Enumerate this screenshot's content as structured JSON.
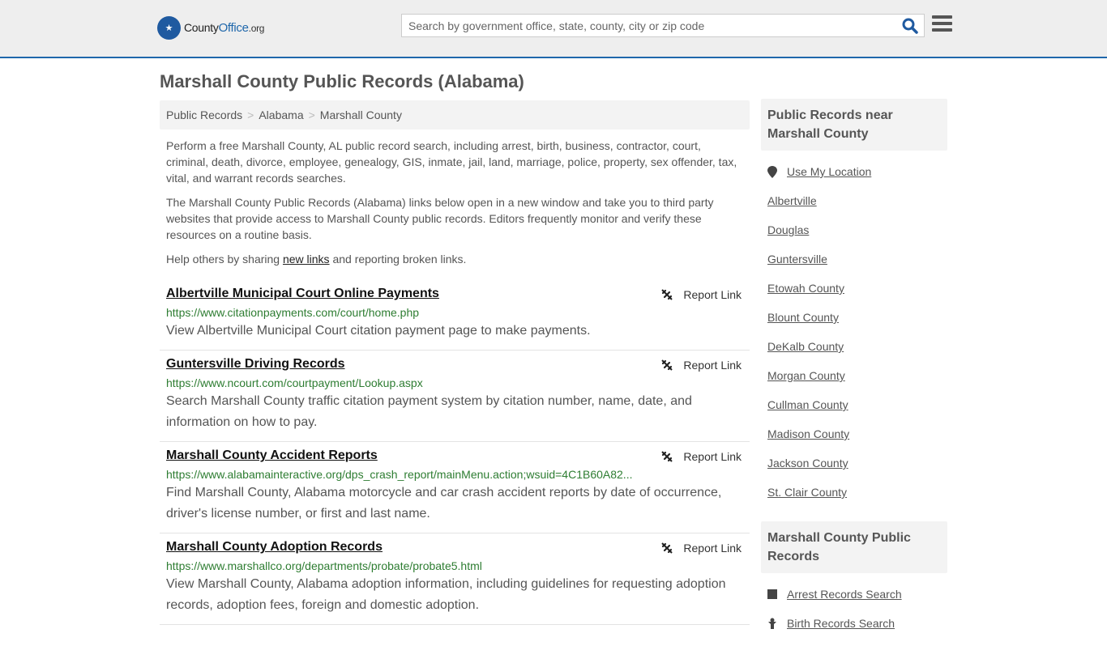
{
  "header": {
    "logo_name": "County",
    "logo_bold": "Office",
    "logo_suffix": ".org",
    "search_placeholder": "Search by government office, state, county, city or zip code"
  },
  "page_title": "Marshall County Public Records (Alabama)",
  "breadcrumb": [
    "Public Records",
    "Alabama",
    "Marshall County"
  ],
  "intro": {
    "p1": "Perform a free Marshall County, AL public record search, including arrest, birth, business, contractor, court, criminal, death, divorce, employee, genealogy, GIS, inmate, jail, land, marriage, police, property, sex offender, tax, vital, and warrant records searches.",
    "p2": "The Marshall County Public Records (Alabama) links below open in a new window and take you to third party websites that provide access to Marshall County public records. Editors frequently monitor and verify these resources on a routine basis.",
    "p3_before": "Help others by sharing ",
    "p3_link": "new links",
    "p3_after": " and reporting broken links."
  },
  "report_label": "Report Link",
  "records": [
    {
      "title": "Albertville Municipal Court Online Payments",
      "url": "https://www.citationpayments.com/court/home.php",
      "desc": "View Albertville Municipal Court citation payment page to make payments."
    },
    {
      "title": "Guntersville Driving Records",
      "url": "https://www.ncourt.com/courtpayment/Lookup.aspx",
      "desc": "Search Marshall County traffic citation payment system by citation number, name, date, and information on how to pay."
    },
    {
      "title": "Marshall County Accident Reports",
      "url": "https://www.alabamainteractive.org/dps_crash_report/mainMenu.action;wsuid=4C1B60A82...",
      "desc": "Find Marshall County, Alabama motorcycle and car crash accident reports by date of occurrence, driver's license number, or first and last name."
    },
    {
      "title": "Marshall County Adoption Records",
      "url": "https://www.marshallco.org/departments/probate/probate5.html",
      "desc": "View Marshall County, Alabama adoption information, including guidelines for requesting adoption records, adoption fees, foreign and domestic adoption."
    }
  ],
  "sidebar": {
    "near_title": "Public Records near Marshall County",
    "use_location": "Use My Location",
    "near": [
      "Albertville",
      "Douglas",
      "Guntersville",
      "Etowah County",
      "Blount County",
      "DeKalb County",
      "Morgan County",
      "Cullman County",
      "Madison County",
      "Jackson County",
      "St. Clair County"
    ],
    "records_title": "Marshall County Public Records",
    "records_links": [
      "Arrest Records Search",
      "Birth Records Search"
    ]
  }
}
